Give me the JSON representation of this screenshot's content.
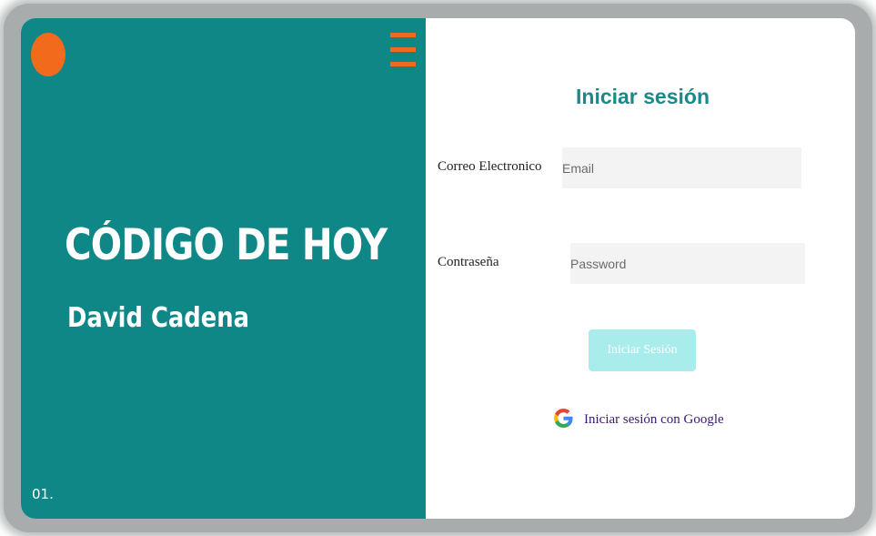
{
  "brand": {
    "title": "CÓDIGO DE HOY",
    "author": "David Cadena",
    "slide_number": "01.",
    "logo_icon": "orange-dot",
    "menu_icon": "hamburger-menu-icon",
    "accent_color": "#f26b1d",
    "panel_color": "#108787"
  },
  "login": {
    "title": "Iniciar sesión",
    "email_label": "Correo Electronico",
    "email_placeholder": "Email",
    "email_value": "",
    "password_label": "Contraseña",
    "password_placeholder": "Password",
    "password_value": "",
    "submit_label": "Iniciar Sesión",
    "google_label": "Iniciar sesión con Google",
    "google_icon": "google-icon",
    "title_color": "#178a8a",
    "button_color": "#a9ecec"
  }
}
